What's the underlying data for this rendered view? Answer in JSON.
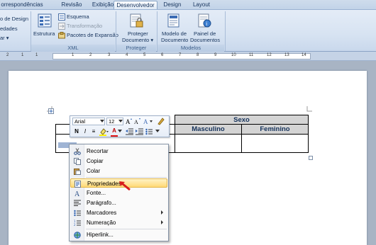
{
  "tabs": [
    "orrespondências",
    "Revisão",
    "Exibição",
    "Desenvolvedor",
    "Design",
    "Layout"
  ],
  "ribbon": {
    "left_items": [
      "o de Design",
      "edades",
      "ar ▾"
    ],
    "xml_group": {
      "estrutura": "Estrutura",
      "esquema": "Esquema",
      "transformacao": "Transformação",
      "pacotes": "Pacotes de Expansão",
      "title": "XML"
    },
    "proteger_group": {
      "button_line1": "Proteger",
      "button_line2": "Documento ▾",
      "title": "Proteger"
    },
    "modelos_group": {
      "modelo_line1": "Modelo de",
      "modelo_line2": "Documento",
      "painel_line1": "Painel de",
      "painel_line2": "Documentos",
      "title": "Modelos"
    }
  },
  "ruler": {
    "numbers": [
      "1",
      "2",
      "1",
      "1",
      "2",
      "3",
      "4",
      "5",
      "6",
      "7",
      "8",
      "9",
      "10",
      "11",
      "12",
      "13",
      "14"
    ]
  },
  "table": {
    "header_merged": "Sexo",
    "sub_headers": [
      "Masculino",
      "Feminino"
    ]
  },
  "mini_toolbar": {
    "font": "Arial",
    "size": "12",
    "buttons": [
      "N",
      "I",
      "≡",
      "A"
    ]
  },
  "context_menu": {
    "items": [
      {
        "label": "Recortar",
        "icon": "scissors-icon"
      },
      {
        "label": "Copiar",
        "icon": "copy-icon"
      },
      {
        "label": "Colar",
        "icon": "paste-icon"
      },
      {
        "label": "Propriedades",
        "icon": "properties-icon",
        "highlighted": true
      },
      {
        "label": "Fonte...",
        "icon": "font-icon"
      },
      {
        "label": "Parágrafo...",
        "icon": "paragraph-icon"
      },
      {
        "label": "Marcadores",
        "icon": "bullets-icon",
        "submenu": true
      },
      {
        "label": "Numeração",
        "icon": "numbering-icon",
        "submenu": true
      },
      {
        "label": "Hiperlink...",
        "icon": "hyperlink-icon"
      }
    ]
  },
  "colors": {
    "accent_highlight": "#ffd975",
    "pointer_arrow": "#d81e1e"
  }
}
